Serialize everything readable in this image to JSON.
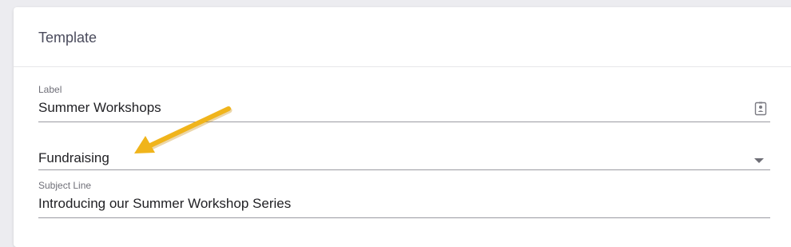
{
  "card": {
    "title": "Template"
  },
  "fields": {
    "label": {
      "label": "Label",
      "value": "Summer Workshops",
      "icon": "contact-card-icon"
    },
    "category": {
      "value": "Fundraising",
      "icon": "dropdown-arrow-icon"
    },
    "subject": {
      "label": "Subject Line",
      "value": "Introducing our Summer Workshop Series"
    }
  },
  "annotation": {
    "icon": "pointer-arrow",
    "color": "#f0b41b"
  }
}
